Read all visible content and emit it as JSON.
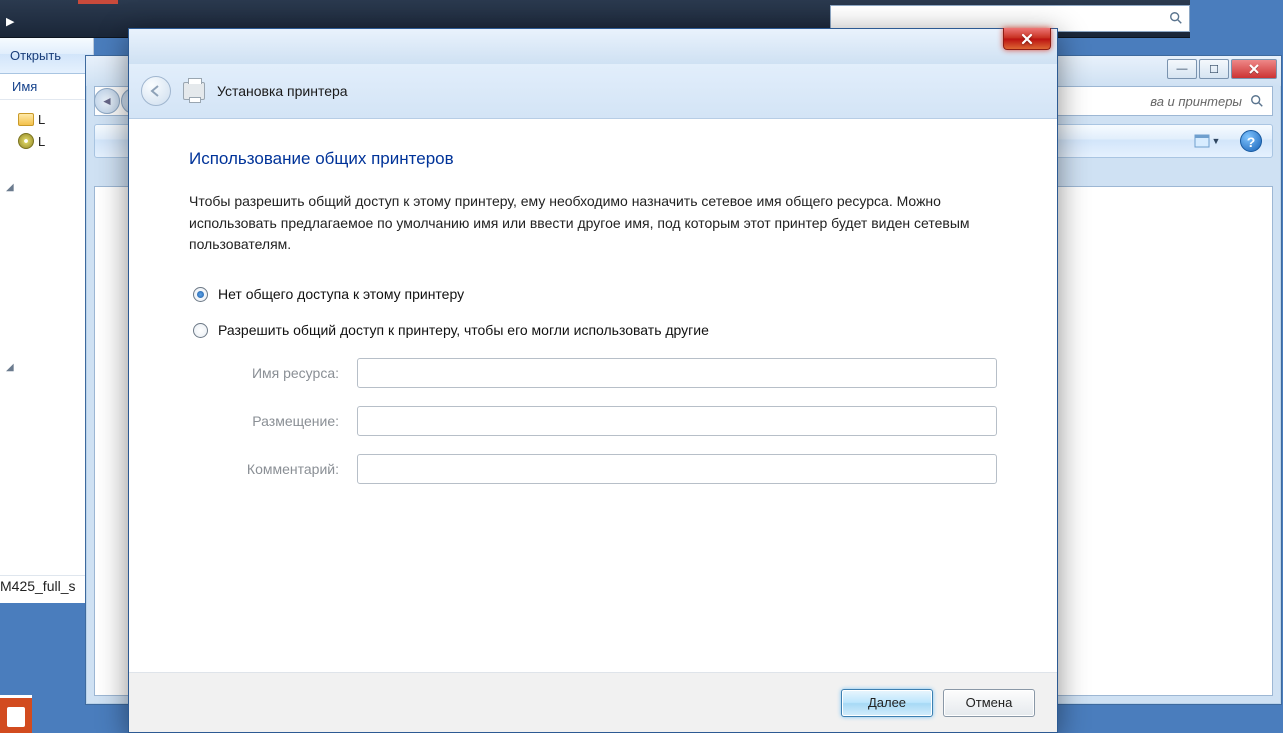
{
  "topnav": {
    "search_placeholder": ""
  },
  "explorer_left": {
    "open_label": "Открыть",
    "name_header": "Имя",
    "tree_item1": "L",
    "tree_item2": "L",
    "file_label": "M425_full_s"
  },
  "devices_window": {
    "crumb_hint": "ва и принтеры",
    "min_tip": "Minimize",
    "max_tip": "Maximize",
    "close_tip": "Close"
  },
  "wizard": {
    "window_title": "Установка принтера",
    "heading": "Использование общих принтеров",
    "description": "Чтобы разрешить общий доступ к этому принтеру, ему необходимо назначить сетевое имя общего ресурса. Можно использовать предлагаемое по умолчанию имя или ввести другое имя, под которым этот принтер будет виден сетевым пользователям.",
    "radio_no_share": "Нет общего доступа к этому принтеру",
    "radio_share": "Разрешить общий доступ к принтеру, чтобы его могли использовать другие",
    "field_sharename": "Имя ресурса:",
    "field_location": "Размещение:",
    "field_comment": "Комментарий:",
    "value_sharename": "",
    "value_location": "",
    "value_comment": "",
    "next_label": "Далее",
    "cancel_label": "Отмена"
  }
}
